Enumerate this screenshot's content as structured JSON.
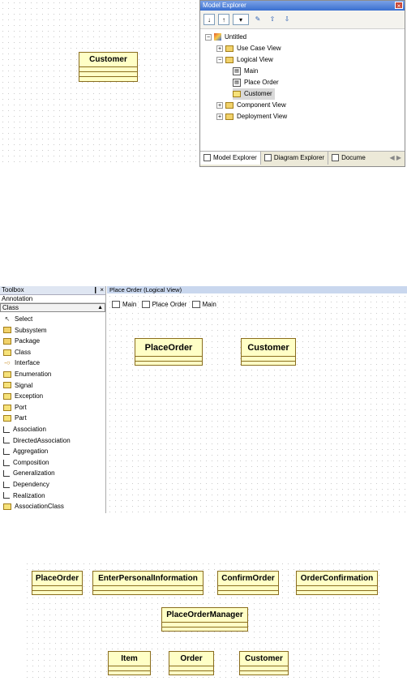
{
  "panel1": {
    "class_box": {
      "name": "Customer"
    }
  },
  "model_explorer": {
    "title": "Model Explorer",
    "toolbar_icons": [
      "sort-ascending-icon",
      "sort-descending-icon",
      "add-element-icon",
      "properties-icon",
      "move-up-icon",
      "move-down-icon"
    ],
    "tree": {
      "root": "Untitled",
      "items": [
        {
          "label": "Use Case View",
          "level": 1,
          "expander": "+",
          "icon": "folder"
        },
        {
          "label": "Logical View",
          "level": 1,
          "expander": "-",
          "icon": "folder"
        },
        {
          "label": "Main",
          "level": 2,
          "icon": "diagram"
        },
        {
          "label": "Place Order",
          "level": 2,
          "icon": "diagram"
        },
        {
          "label": "Customer",
          "level": 2,
          "icon": "class",
          "selected": true
        },
        {
          "label": "Component View",
          "level": 1,
          "expander": "+",
          "icon": "folder"
        },
        {
          "label": "Deployment View",
          "level": 1,
          "expander": "+",
          "icon": "folder"
        }
      ]
    },
    "tabs": [
      {
        "label": "Model Explorer"
      },
      {
        "label": "Diagram Explorer"
      },
      {
        "label": "Docume"
      }
    ]
  },
  "toolbox": {
    "title": "Toolbox",
    "pin": "❙ ×",
    "categories": [
      "Annotation",
      "Class"
    ],
    "items": [
      {
        "label": "Select",
        "icon": "arrow"
      },
      {
        "label": "Subsystem",
        "icon": "folder"
      },
      {
        "label": "Package",
        "icon": "folder"
      },
      {
        "label": "Class",
        "icon": "class"
      },
      {
        "label": "Interface",
        "icon": "interface"
      },
      {
        "label": "Enumeration",
        "icon": "class"
      },
      {
        "label": "Signal",
        "icon": "class"
      },
      {
        "label": "Exception",
        "icon": "class"
      },
      {
        "label": "Port",
        "icon": "class"
      },
      {
        "label": "Part",
        "icon": "class"
      },
      {
        "label": "Association",
        "icon": "line"
      },
      {
        "label": "DirectedAssociation",
        "icon": "line"
      },
      {
        "label": "Aggregation",
        "icon": "line"
      },
      {
        "label": "Composition",
        "icon": "line"
      },
      {
        "label": "Generalization",
        "icon": "line"
      },
      {
        "label": "Dependency",
        "icon": "line"
      },
      {
        "label": "Realization",
        "icon": "line"
      },
      {
        "label": "AssociationClass",
        "icon": "class"
      }
    ]
  },
  "diagram2": {
    "title": "Place Order (Logical View)",
    "breadcrumb": [
      "Main",
      "Place Order",
      "Main"
    ],
    "classes": [
      "PlaceOrder",
      "Customer"
    ]
  },
  "panel3": {
    "classes": [
      "PlaceOrder",
      "EnterPersonalInformation",
      "ConfirmOrder",
      "OrderConfirmation",
      "PlaceOrderManager",
      "Item",
      "Order",
      "Customer"
    ]
  }
}
